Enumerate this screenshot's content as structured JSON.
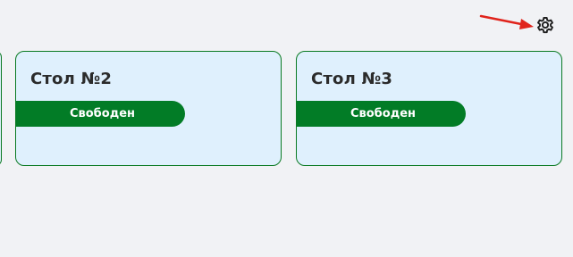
{
  "tables": [
    {
      "title": "",
      "status": ""
    },
    {
      "title": "Стол №2",
      "status": "Свободен"
    },
    {
      "title": "Стол №3",
      "status": "Свободен"
    }
  ],
  "toolbar": {
    "settings_icon": "gear-icon"
  },
  "colors": {
    "background": "#f1f2f5",
    "card_background": "#dff0fd",
    "card_border": "#0a7a22",
    "status_free": "#027c26",
    "annotation_arrow": "#e0231b"
  }
}
